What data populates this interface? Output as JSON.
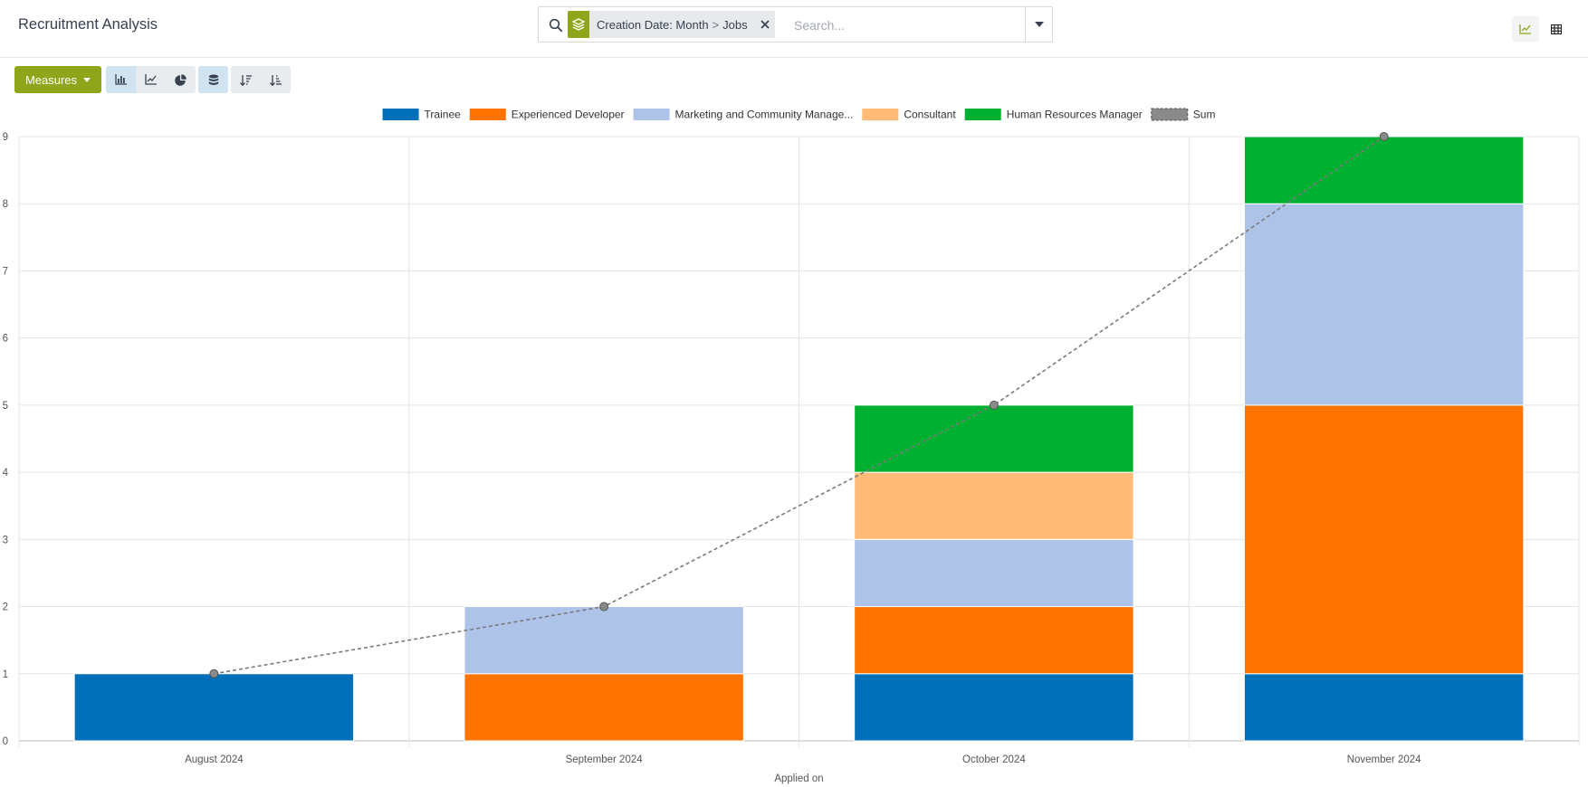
{
  "app": {
    "title": "Recruitment Analysis"
  },
  "search": {
    "facet_label_1": "Creation Date: Month",
    "facet_separator": ">",
    "facet_label_2": "Jobs",
    "placeholder": "Search..."
  },
  "toolbar": {
    "measures_label": "Measures"
  },
  "icons": {
    "search": "search-icon",
    "facet": "layers-icon",
    "remove": "close-icon",
    "toggle": "caret-down-icon",
    "graph_view": "line-chart-icon",
    "pivot_view": "table-icon",
    "bar": "bar-chart-icon",
    "line": "line-chart-icon",
    "pie": "pie-chart-icon",
    "stacked": "database-stack-icon",
    "desc": "sort-descending-icon",
    "asc": "sort-ascending-icon"
  },
  "colors": {
    "accent": "#8fa61b",
    "active_button": "#cfe3f1"
  },
  "chart_data": {
    "type": "bar",
    "stacked": true,
    "categories": [
      "August 2024",
      "September 2024",
      "October 2024",
      "November 2024"
    ],
    "series": [
      {
        "name": "Trainee",
        "color": "#0170b9",
        "values": [
          1,
          0,
          1,
          1
        ]
      },
      {
        "name": "Experienced Developer",
        "color": "#ff7300",
        "values": [
          0,
          1,
          1,
          4
        ]
      },
      {
        "name": "Marketing and Community Manage...",
        "color": "#aec3e8",
        "values": [
          0,
          1,
          1,
          3
        ]
      },
      {
        "name": "Consultant",
        "color": "#ffbb77",
        "values": [
          0,
          0,
          1,
          0
        ]
      },
      {
        "name": "Human Resources Manager",
        "color": "#00b030",
        "values": [
          0,
          0,
          1,
          1
        ]
      }
    ],
    "cumulative": {
      "name": "Sum",
      "type": "line",
      "style": "dashed",
      "values": [
        1,
        2,
        5,
        9
      ]
    },
    "xlabel": "Applied on",
    "ylabel": "",
    "ylim": [
      0,
      9
    ],
    "yticks": [
      0,
      1,
      2,
      3,
      4,
      5,
      6,
      7,
      8,
      9
    ],
    "legend": "top-center",
    "grid": true
  }
}
